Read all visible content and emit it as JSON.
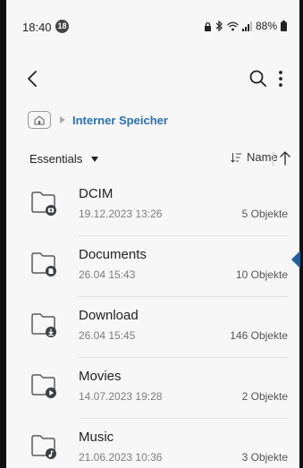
{
  "status": {
    "time": "18:40",
    "notification_count": "18",
    "battery": "88%"
  },
  "toolbar": {
    "back_icon": "back-chevron-icon",
    "search_icon": "search-icon",
    "more_icon": "more-vertical-icon"
  },
  "breadcrumb": {
    "home_icon": "home-icon",
    "path": "Interner Speicher"
  },
  "sort": {
    "filter_label": "Essentials",
    "sort_label": "Name",
    "direction": "ascending"
  },
  "files": [
    {
      "name": "DCIM",
      "date": "19.12.2023 13:26",
      "count": "5 Objekte",
      "badge_icon": "camera-icon"
    },
    {
      "name": "Documents",
      "date": "26.04 15:43",
      "count": "10 Objekte",
      "badge_icon": "document-icon"
    },
    {
      "name": "Download",
      "date": "26.04 15:45",
      "count": "146 Objekte",
      "badge_icon": "download-icon"
    },
    {
      "name": "Movies",
      "date": "14.07.2023 19:28",
      "count": "2 Objekte",
      "badge_icon": "play-icon"
    },
    {
      "name": "Music",
      "date": "21.06.2023 10:36",
      "count": "3 Objekte",
      "badge_icon": "music-note-icon"
    }
  ],
  "colors": {
    "accent": "#2b6fb5",
    "background": "#f7f7f7",
    "edge_handle": "#1e5fa3"
  }
}
